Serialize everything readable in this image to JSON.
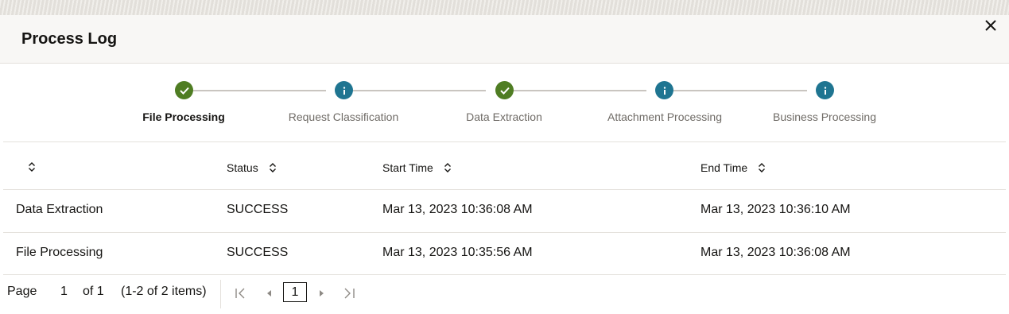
{
  "dialog": {
    "title": "Process Log"
  },
  "stepper": {
    "steps": [
      {
        "label": "File Processing",
        "status": "completed",
        "active": true
      },
      {
        "label": "Request Classification",
        "status": "info",
        "active": false
      },
      {
        "label": "Data Extraction",
        "status": "completed",
        "active": false
      },
      {
        "label": "Attachment Processing",
        "status": "info",
        "active": false
      },
      {
        "label": "Business Processing",
        "status": "info",
        "active": false
      }
    ]
  },
  "table": {
    "columns": [
      {
        "label": ""
      },
      {
        "label": "Status"
      },
      {
        "label": "Start Time"
      },
      {
        "label": "End Time"
      }
    ],
    "rows": [
      {
        "name": "Data Extraction",
        "status": "SUCCESS",
        "start": "Mar 13, 2023 10:36:08 AM",
        "end": "Mar 13, 2023 10:36:10 AM"
      },
      {
        "name": "File Processing",
        "status": "SUCCESS",
        "start": "Mar 13, 2023 10:35:56 AM",
        "end": "Mar 13, 2023 10:36:08 AM"
      }
    ]
  },
  "pagination": {
    "page_label": "Page",
    "page_value": "1",
    "of_label": "of 1",
    "items_label": "(1-2 of 2 items)",
    "current_page": "1"
  },
  "colors": {
    "completed": "#4f7d23",
    "info": "#1f7591",
    "header_bg": "#f8f7f5"
  }
}
